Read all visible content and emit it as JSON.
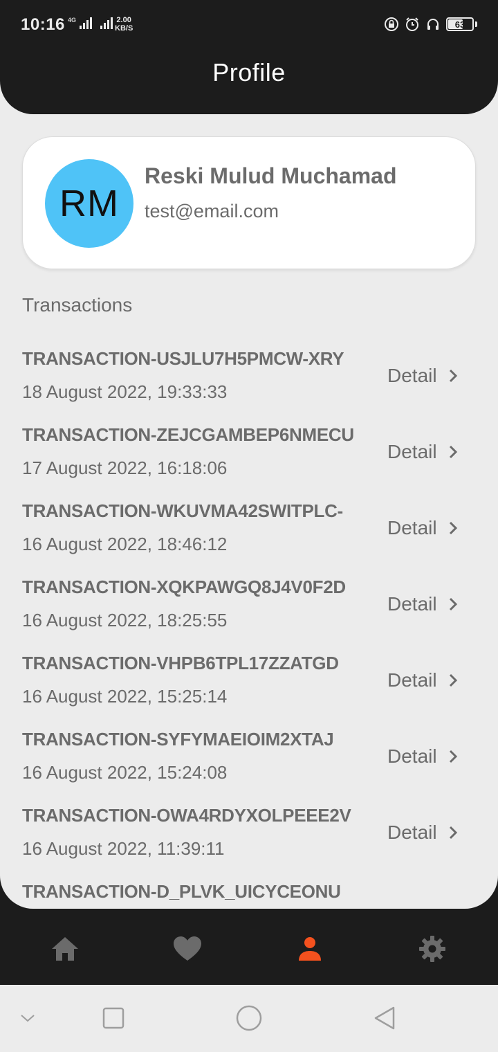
{
  "status_bar": {
    "time": "10:16",
    "network_tag": "4G",
    "speed_value": "2.00",
    "speed_unit": "KB/S",
    "battery_level": "63",
    "battery_fraction": 0.63,
    "icons": [
      "signal-icon",
      "signal-icon",
      "lock-rotation-icon",
      "alarm-icon",
      "headphones-icon",
      "battery-icon"
    ]
  },
  "header": {
    "title": "Profile"
  },
  "profile": {
    "initials": "RM",
    "name": "Reski Mulud Muchamad",
    "email": "test@email.com",
    "avatar_color": "#4fc3f7"
  },
  "transactions": {
    "section_title": "Transactions",
    "detail_label": "Detail",
    "items": [
      {
        "id": "TRANSACTION-USJLU7H5PMCW-XRY",
        "date": "18 August 2022, 19:33:33"
      },
      {
        "id": "TRANSACTION-ZEJCGAMBEP6NMECU",
        "date": "17 August 2022, 16:18:06"
      },
      {
        "id": "TRANSACTION-WKUVMA42SWITPLC-",
        "date": "16 August 2022, 18:46:12"
      },
      {
        "id": "TRANSACTION-XQKPAWGQ8J4V0F2D",
        "date": "16 August 2022, 18:25:55"
      },
      {
        "id": "TRANSACTION-VHPB6TPL17ZZATGD",
        "date": "16 August 2022, 15:25:14"
      },
      {
        "id": "TRANSACTION-SYFYMAEIOIM2XTAJ",
        "date": "16 August 2022, 15:24:08"
      },
      {
        "id": "TRANSACTION-OWA4RDYXOLPEEE2V",
        "date": "16 August 2022, 11:39:11"
      },
      {
        "id": "TRANSACTION-D_PLVK_UICYCEONU",
        "date": ""
      }
    ]
  },
  "bottom_nav": {
    "items": [
      {
        "icon": "home-icon",
        "active": false
      },
      {
        "icon": "heart-icon",
        "active": false
      },
      {
        "icon": "person-icon",
        "active": true
      },
      {
        "icon": "gear-icon",
        "active": false
      }
    ],
    "active_color": "#f4511e",
    "inactive_color": "#6b6b6b"
  },
  "system_nav": {
    "icons": [
      "chevron-down-icon",
      "recents-icon",
      "home-circle-icon",
      "back-icon"
    ]
  }
}
